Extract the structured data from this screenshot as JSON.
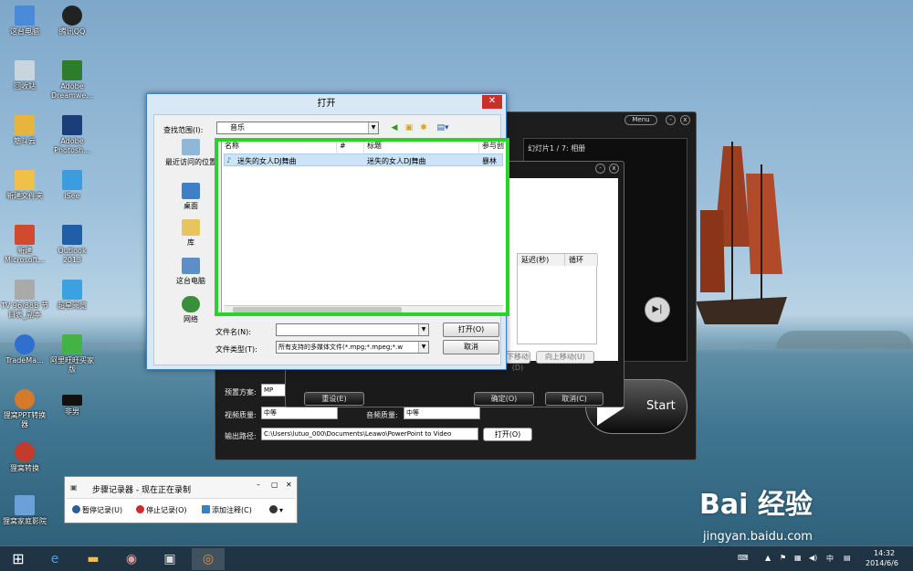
{
  "desktop": {
    "icons": [
      {
        "label": "这台电脑",
        "color": "#4a8ad8"
      },
      {
        "label": "腾讯QQ",
        "color": "#222"
      },
      {
        "label": "回收站",
        "color": "#c8d4de"
      },
      {
        "label": "Adobe Dreamwe...",
        "color": "#2d7d2d"
      },
      {
        "label": "筋斗云",
        "color": "#e8b440"
      },
      {
        "label": "Adobe Photosh...",
        "color": "#1b3d78"
      },
      {
        "label": "新建文件夹",
        "color": "#f0c04a"
      },
      {
        "label": "iSee",
        "color": "#3b9de0"
      },
      {
        "label": "新建 Microsoft...",
        "color": "#d04a30"
      },
      {
        "label": "Outlook 2013",
        "color": "#1f5fa8"
      },
      {
        "label": "TV 96/88B 节目表_副本",
        "color": "#aaa"
      },
      {
        "label": "超星阅览",
        "color": "#3ba1e0"
      },
      {
        "label": "TradeMa...",
        "color": "#2f6fd0"
      },
      {
        "label": "阿里旺旺买家版",
        "color": "#43b346"
      },
      {
        "label": "狸窝PPT转换器",
        "color": "#d47a2a"
      },
      {
        "label": "非男",
        "color": "#111"
      },
      {
        "label": "狸窝转换",
        "color": "#c23b2b"
      },
      {
        "label": "狸窝家庭影院",
        "color": "#6ba0d8"
      }
    ]
  },
  "app": {
    "menu_label": "Menu",
    "min_label": "-",
    "close_label": "x",
    "preview_title": "幻灯片1 / 7: 相册",
    "start_label": "Start",
    "preset_label": "预置方案:",
    "preset_value": "MP",
    "video_quality_label": "视频质量:",
    "video_quality_value": "中等",
    "audio_quality_label": "音频质量:",
    "audio_quality_value": "中等",
    "output_label": "输出路径:",
    "output_value": "C:\\Users\\lutuo_000\\Documents\\Leawo\\PowerPoint to Video",
    "open_button": "打开(O)"
  },
  "inner": {
    "columns": [
      "延迟(秒)",
      "循环"
    ],
    "move_down": "下移动(D)",
    "move_up": "向上移动(U)",
    "reset": "重设(E)",
    "ok": "确定(O)",
    "cancel": "取消(C)"
  },
  "dialog": {
    "title": "打开",
    "lookin_label": "查找范围(I):",
    "lookin_value": "音乐",
    "places": [
      {
        "label": "最近访问的位置",
        "color": "#8fb7d8"
      },
      {
        "label": "桌面",
        "color": "#3f7fc7"
      },
      {
        "label": "库",
        "color": "#e8c460"
      },
      {
        "label": "这台电脑",
        "color": "#5c8ec8"
      },
      {
        "label": "网络",
        "color": "#3b8f3b"
      }
    ],
    "columns": [
      "名称",
      "#",
      "标题",
      "参与创"
    ],
    "rows": [
      {
        "name": "迷失的女人DJ舞曲",
        "num": "",
        "title": "迷失的女人DJ舞曲",
        "artist": "暴林"
      }
    ],
    "filename_label": "文件名(N):",
    "filename_value": "",
    "filetype_label": "文件类型(T):",
    "filetype_value": "所有支持的多媒体文件(*.mpg;*.mpeg;*.w",
    "open_button": "打开(O)",
    "cancel_button": "取消",
    "highlight_color": "#28d428"
  },
  "recorder": {
    "title": "步骤记录器 - 现在正在录制",
    "pause": "暂停记录(U)",
    "stop": "停止记录(O)",
    "add_comment": "添加注释(C)"
  },
  "taskbar": {
    "ime": "中",
    "time": "14:32",
    "date": "2014/6/6"
  },
  "watermark": {
    "brand": "Bai 经验",
    "url": "jingyan.baidu.com"
  }
}
